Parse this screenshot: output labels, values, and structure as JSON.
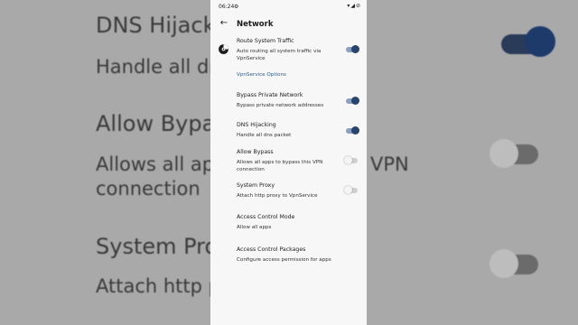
{
  "background": {
    "lines": [
      {
        "text": "DNS Hijacki",
        "kind": "title"
      },
      {
        "text": "Handle all dn",
        "kind": "sub"
      },
      {
        "text": "Allow Bypa",
        "kind": "title"
      },
      {
        "text": "Allows all ap",
        "kind": "sub"
      },
      {
        "text": "VPN",
        "kind": "sub"
      },
      {
        "text": "connection",
        "kind": "sub"
      },
      {
        "text": "System Pro",
        "kind": "title"
      },
      {
        "text": "Attach http p",
        "kind": "sub"
      }
    ]
  },
  "status_bar": {
    "time": "06:24",
    "settings_glyph": "⚙",
    "right_icons": "▾◢⊘"
  },
  "app_bar": {
    "back_glyph": "←",
    "title": "Network"
  },
  "settings": {
    "route_system_traffic": {
      "title": "Route System Traffic",
      "summary": "Auto routing all system traffic via VpnService",
      "enabled": true
    },
    "section_vpnservice": "VpnService Options",
    "bypass_private_network": {
      "title": "Bypass Private Network",
      "summary": "Bypass private network addresses",
      "enabled": true
    },
    "dns_hijacking": {
      "title": "DNS Hijacking",
      "summary": "Handle all dns packet",
      "enabled": true
    },
    "allow_bypass": {
      "title": "Allow Bypass",
      "summary": "Allows all apps to bypass this VPN connection",
      "enabled": false
    },
    "system_proxy": {
      "title": "System Proxy",
      "summary": "Attach http proxy to VpnService",
      "enabled": false
    },
    "access_control_mode": {
      "title": "Access Control Mode",
      "summary": "Allow all apps"
    },
    "access_control_packages": {
      "title": "Access Control Packages",
      "summary": "Configure access permission for apps"
    }
  },
  "colors": {
    "accent": "#27446e",
    "section": "#2f5a8a",
    "surface": "#f7f7f8"
  }
}
